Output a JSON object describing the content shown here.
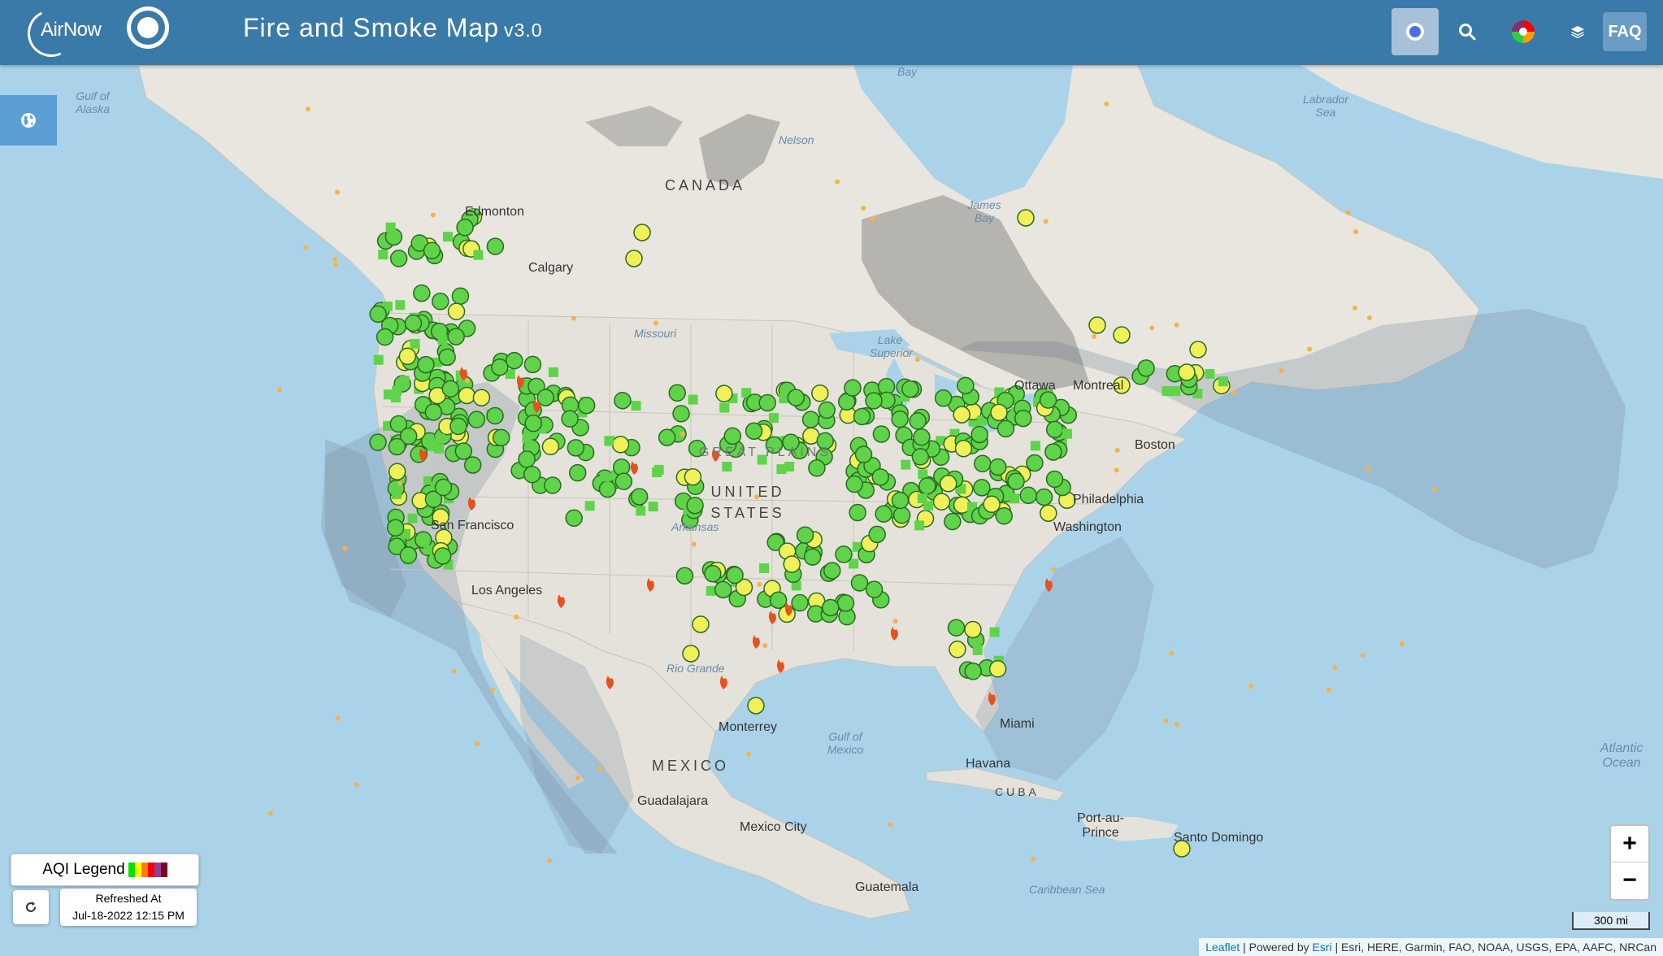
{
  "header": {
    "title": "Fire and Smoke Map",
    "version": "v3.0",
    "logo_text": "AirNow",
    "faq_label": "FAQ"
  },
  "legend": {
    "label": "AQI Legend",
    "colors": [
      "#00e400",
      "#ffff00",
      "#ff7e00",
      "#ff0000",
      "#8f3f97",
      "#7e0023"
    ]
  },
  "refresh": {
    "line1": "Refreshed At",
    "line2": "Jul-18-2022 12:15 PM"
  },
  "zoom": {
    "in": "+",
    "out": "−"
  },
  "scale": "300 mi",
  "attribution": {
    "leaflet": "Leaflet",
    "powered": " | Powered by ",
    "esri": "Esri",
    "sources": " | Esri, HERE, Garmin, FAO, NOAA, USGS, EPA, AAFC, NRCan"
  },
  "map_labels": {
    "canada": "CANADA",
    "united_states": "UNITED STATES",
    "mexico": "MEXICO",
    "cuba": "CUBA",
    "great_plains": "GREAT PLAINS",
    "edmonton": "Edmonton",
    "calgary": "Calgary",
    "ottawa": "Ottawa",
    "montreal": "Montreal",
    "boston": "Boston",
    "philadelphia": "Philadelphia",
    "washington": "Washington",
    "san_francisco": "San Francisco",
    "los_angeles": "Los Angeles",
    "monterrey": "Monterrey",
    "guadalajara": "Guadalajara",
    "mexico_city": "Mexico City",
    "miami": "Miami",
    "havana": "Havana",
    "port_au_prince": "Port-au-Prince",
    "santo_domingo": "Santo Domingo",
    "guatemala": "Guatemala",
    "gulf_alaska": "Gulf of Alaska",
    "labrador_sea": "Labrador Sea",
    "james_bay": "James Bay",
    "bay": "Bay",
    "gulf_mexico": "Gulf of Mexico",
    "caribbean": "Caribbean Sea",
    "atlantic": "Atlantic Ocean",
    "lake_superior": "Lake Superior",
    "missouri": "Missouri",
    "arkansas": "Arkansas",
    "rio_grande": "Rio Grande",
    "nelson": "Nelson"
  }
}
